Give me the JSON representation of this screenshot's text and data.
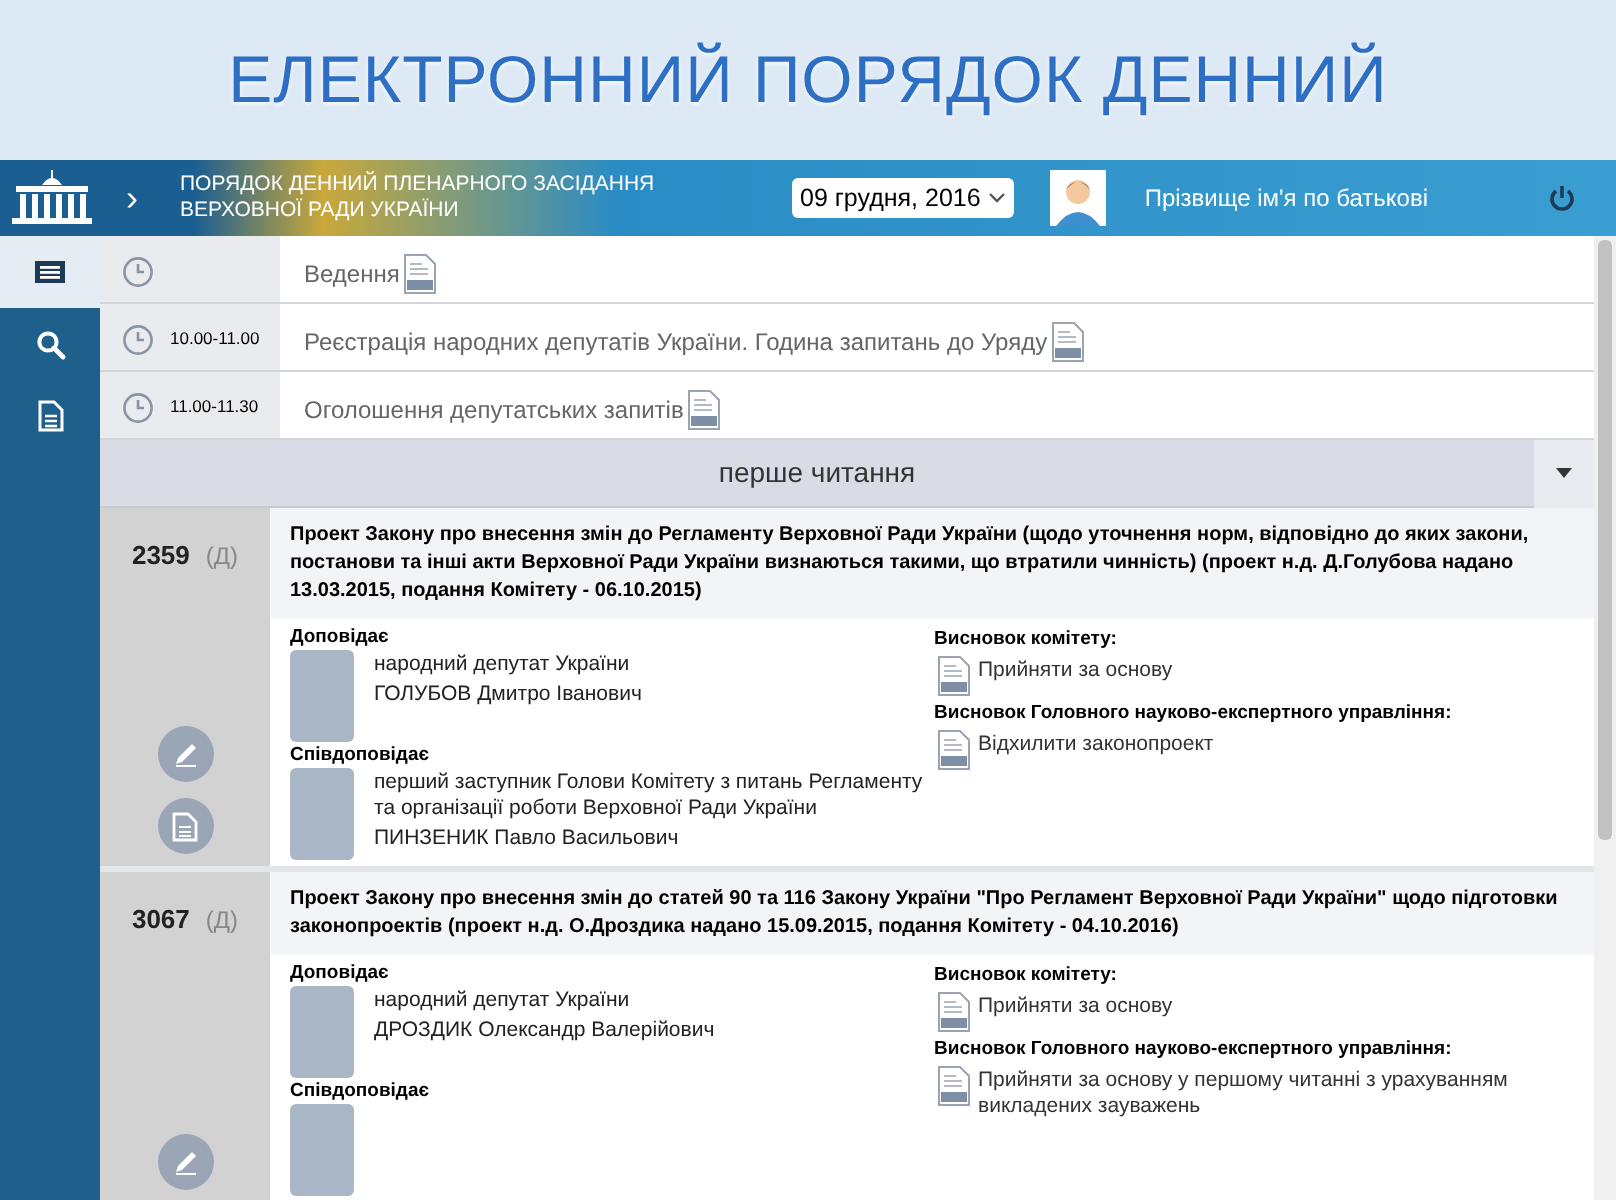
{
  "page_title": "ЕЛЕКТРОННИЙ ПОРЯДОК ДЕННИЙ",
  "header": {
    "title_lines": [
      "ПОРЯДОК ДЕННИЙ ПЛЕНАРНОГО ЗАСІДАННЯ",
      "ВЕРХОВНОЇ РАДИ УКРАЇНИ"
    ],
    "expand_arrow": "›",
    "date": "09 грудня, 2016",
    "user_name": "Прізвище ім'я по батькові"
  },
  "sidebar": {
    "items": [
      {
        "kind": "agenda",
        "selected": true
      },
      {
        "kind": "search",
        "selected": false
      },
      {
        "kind": "document",
        "selected": false
      }
    ]
  },
  "agenda_items": [
    {
      "title": "Ведення"
    },
    {
      "time": "10.00-11.00",
      "title": "Реєстрація народних депутатів України. Година запитань до Уряду"
    },
    {
      "time": "11.00-11.30",
      "title": "Оголошення депутатських запитів"
    }
  ],
  "section": {
    "title": "перше читання"
  },
  "bills": [
    {
      "number": "2359",
      "tag": "(Д)",
      "title": "Проект Закону про внесення змін до Регламенту Верховної Ради України (щодо уточнення норм, відповідно до яких закони, постанови та інші акти Верховної Ради України визнаються такими, що втратили чинність) (проект н.д. Д.Голубова надано 13.03.2015, подання Комітету - 06.10.2015)",
      "actions": [
        {
          "kind": "edit"
        },
        {
          "kind": "document"
        }
      ],
      "reporters": [
        {
          "role": "Доповідає",
          "position": "народний депутат України",
          "name": "ГОЛУБОВ Дмитро Іванович"
        },
        {
          "role": "Співдоповідає",
          "position": "перший заступник Голови Комітету з питань Регламенту та організації роботи Верховної Ради України",
          "name": "ПИНЗЕНИК Павло Васильович"
        }
      ],
      "conclusions": [
        {
          "heading": "Висновок комітету:",
          "text": "Прийняти за основу"
        },
        {
          "heading": "Висновок Головного науково-експертного управління:",
          "text": "Відхилити законопроект"
        }
      ]
    },
    {
      "number": "3067",
      "tag": "(Д)",
      "title": "Проект Закону про внесення змін до статей 90 та 116 Закону України \"Про Регламент Верховної Ради України\" щодо підготовки законопроектів (проект н.д. О.Дроздика надано 15.09.2015, подання Комітету - 04.10.2016)",
      "actions": [
        {
          "kind": "edit"
        }
      ],
      "reporters": [
        {
          "role": "Доповідає",
          "position": "народний депутат України",
          "name": "ДРОЗДИК Олександр Валерійович"
        },
        {
          "role": "Співдоповідає"
        }
      ],
      "conclusions": [
        {
          "heading": "Висновок комітету:",
          "text": "Прийняти за основу"
        },
        {
          "heading": "Висновок Головного науково-експертного управління:",
          "text": "Прийняти за основу у першому читанні з урахуванням викладених зауважень"
        }
      ]
    }
  ]
}
